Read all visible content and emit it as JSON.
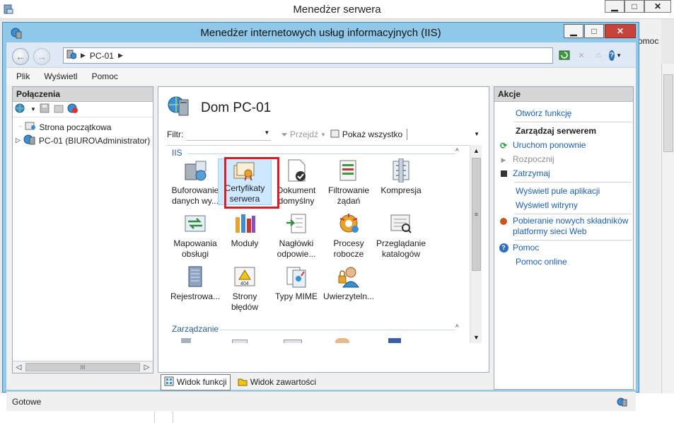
{
  "outer_window": {
    "title": "Menedżer serwera",
    "caption_buttons": [
      "▁",
      "□",
      "✕"
    ],
    "side_text": "omoc"
  },
  "iis_window": {
    "title": "Menedżer internetowych usług informacyjnych (IIS)",
    "caption_buttons": [
      "▁",
      "□",
      "✕"
    ]
  },
  "address": {
    "crumbs": [
      "PC-01"
    ],
    "help_label": "?"
  },
  "menu": [
    "Plik",
    "Wyświetl",
    "Pomoc"
  ],
  "connections": {
    "header": "Połączenia",
    "tree": [
      {
        "label": "Strona początkowa"
      },
      {
        "label": "PC-01 (BIURO\\Administrator)"
      }
    ],
    "scroll_grip": "III"
  },
  "center": {
    "title": "Dom PC-01",
    "filter_label": "Filtr:",
    "go_label": "Przejdź",
    "show_all_label": "Pokaż wszystko",
    "groups": [
      {
        "label": "IIS"
      },
      {
        "label": "Zarządzanie"
      }
    ],
    "features": [
      {
        "line1": "Buforowanie",
        "line2": "danych wy...",
        "icon": "cache-icon"
      },
      {
        "line1": "Certyfikaty",
        "line2": "serwera",
        "icon": "certificate-icon"
      },
      {
        "line1": "Dokument",
        "line2": "domyślny",
        "icon": "default-document-icon"
      },
      {
        "line1": "Filtrowanie",
        "line2": "żądań",
        "icon": "request-filtering-icon"
      },
      {
        "line1": "Kompresja",
        "line2": "",
        "icon": "compression-icon"
      },
      {
        "line1": "Mapowania",
        "line2": "obsługi",
        "icon": "handler-mappings-icon"
      },
      {
        "line1": "Moduły",
        "line2": "",
        "icon": "modules-icon"
      },
      {
        "line1": "Nagłówki",
        "line2": "odpowie...",
        "icon": "response-headers-icon"
      },
      {
        "line1": "Procesy",
        "line2": "robocze",
        "icon": "worker-processes-icon"
      },
      {
        "line1": "Przeglądanie",
        "line2": "katalogów",
        "icon": "directory-browsing-icon"
      },
      {
        "line1": "Rejestrowa...",
        "line2": "",
        "icon": "logging-icon"
      },
      {
        "line1": "Strony",
        "line2": "błędów",
        "icon": "error-pages-icon"
      },
      {
        "line1": "Typy MIME",
        "line2": "",
        "icon": "mime-types-icon"
      },
      {
        "line1": "Uwierzyteln...",
        "line2": "",
        "icon": "authentication-icon"
      }
    ],
    "view_tabs": [
      {
        "label": "Widok funkcji",
        "active": true
      },
      {
        "label": "Widok zawartości",
        "active": false
      }
    ]
  },
  "actions": {
    "header": "Akcje",
    "open_feature": "Otwórz funkcję",
    "manage_heading": "Zarządzaj serwerem",
    "restart": "Uruchom ponownie",
    "start": "Rozpocznij",
    "stop": "Zatrzymaj",
    "view_app_pools": "Wyświetl pule aplikacji",
    "view_sites": "Wyświetl witryny",
    "get_components_line1": "Pobieranie nowych składników",
    "get_components_line2": "platformy sieci Web",
    "help": "Pomoc",
    "help_online": "Pomoc online"
  },
  "status": {
    "text": "Gotowe"
  },
  "colors": {
    "iis_frame": "#8fc8e8",
    "link": "#1a5fb4",
    "highlight": "#e01b24",
    "close_button": "#c7433b"
  }
}
